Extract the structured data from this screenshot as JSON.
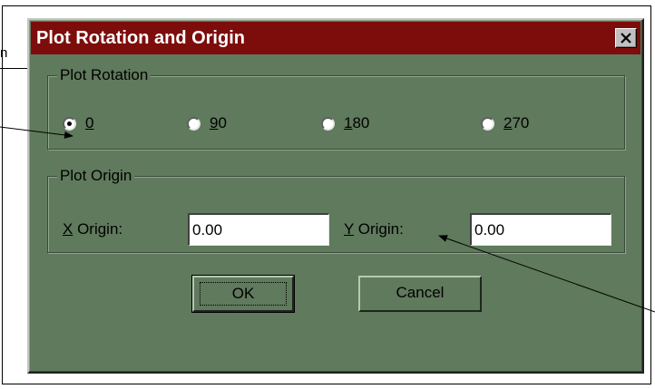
{
  "margin_fragment": "n",
  "dialog": {
    "title": "Plot Rotation and Origin",
    "close_label": "X"
  },
  "plot_rotation": {
    "group_label": "Plot Rotation",
    "options": [
      {
        "mnemonic": "0",
        "rest": "",
        "selected": true
      },
      {
        "mnemonic": "9",
        "rest": "0",
        "selected": false
      },
      {
        "mnemonic": "1",
        "rest": "80",
        "selected": false
      },
      {
        "mnemonic": "2",
        "rest": "70",
        "selected": false
      }
    ]
  },
  "plot_origin": {
    "group_label": "Plot Origin",
    "x_label_mnemonic": "X",
    "x_label_rest": " Origin:",
    "x_value": "0.00",
    "y_label_mnemonic": "Y",
    "y_label_rest": " Origin:",
    "y_value": "0.00"
  },
  "buttons": {
    "ok_label": "OK",
    "cancel_label": "Cancel"
  },
  "colors": {
    "dialog_bg": "#5f7a5c",
    "titlebar_bg": "#7c0d0b",
    "title_text": "#ffffff"
  }
}
